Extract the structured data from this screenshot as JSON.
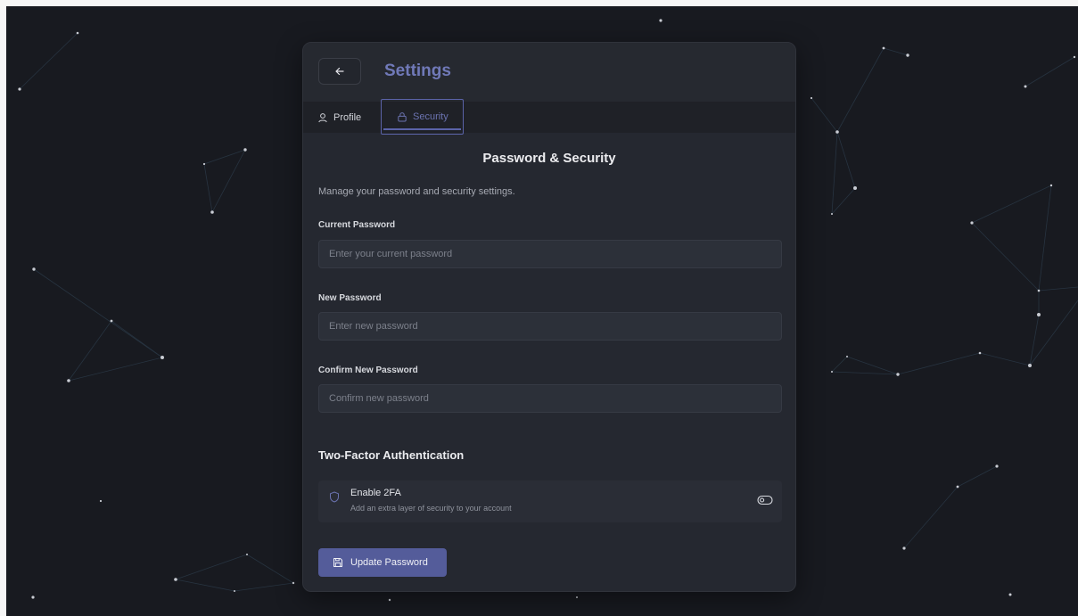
{
  "header": {
    "title": "Settings",
    "back_icon": "arrow-left-icon"
  },
  "tabs": [
    {
      "label": "Profile",
      "icon": "user-icon",
      "active": false
    },
    {
      "label": "Security",
      "icon": "lock-icon",
      "active": true
    }
  ],
  "section": {
    "title": "Password & Security",
    "description": "Manage your password and security settings."
  },
  "fields": {
    "current": {
      "label": "Current Password",
      "placeholder": "Enter your current password",
      "value": ""
    },
    "new": {
      "label": "New Password",
      "placeholder": "Enter new password",
      "value": ""
    },
    "confirm": {
      "label": "Confirm New Password",
      "placeholder": "Confirm new password",
      "value": ""
    }
  },
  "twofa": {
    "title": "Two-Factor Authentication",
    "label": "Enable 2FA",
    "sublabel": "Add an extra layer of security to your account",
    "enabled": false,
    "icon": "shield-icon"
  },
  "submit": {
    "label": "Update Password",
    "icon": "save-icon"
  },
  "colors": {
    "accent": "#5b63a8",
    "button": "#545c9a",
    "panel": "#252830",
    "background": "#181a20"
  }
}
